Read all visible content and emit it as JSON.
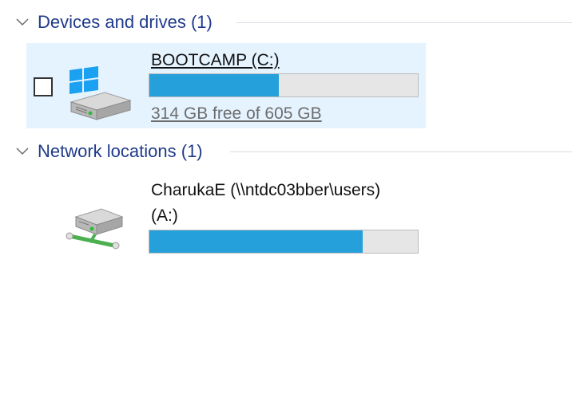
{
  "groups": {
    "devices": {
      "title": "Devices and drives (1)",
      "drives": [
        {
          "name": "BOOTCAMP (C:)",
          "free_text": "314 GB free of 605 GB",
          "used_fraction": 0.481,
          "selected": true,
          "icon": "windows-hard-drive-icon"
        }
      ]
    },
    "network": {
      "title": "Network locations (1)",
      "drives": [
        {
          "name_line1": "CharukaE (\\\\ntdc03bber\\users)",
          "name_line2": "(A:)",
          "used_fraction": 0.795,
          "icon": "network-drive-icon"
        }
      ]
    }
  },
  "colors": {
    "accent": "#26a0da",
    "header_text": "#1f3a8a",
    "selection": "#e5f3ff",
    "bar_track": "#e6e6e6"
  }
}
